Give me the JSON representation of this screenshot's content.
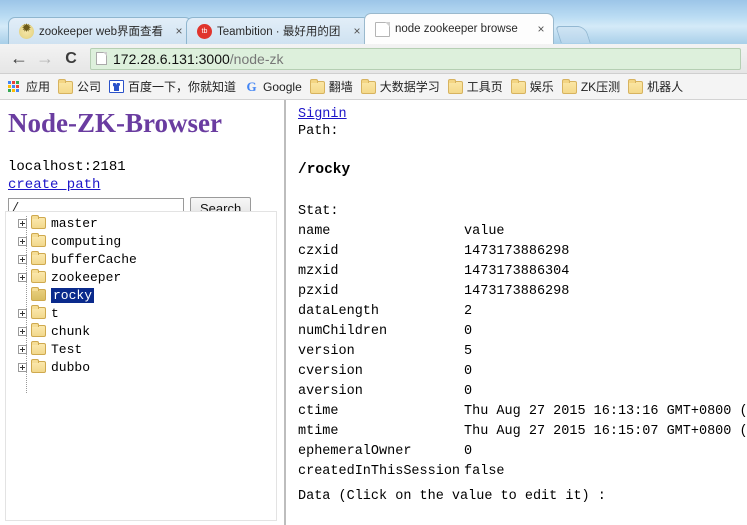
{
  "browser": {
    "tabs": [
      {
        "title": "zookeeper web界面查看",
        "favicon": "zookeeper-favicon",
        "active": false,
        "close_label": "×"
      },
      {
        "title": "Teambition · 最好用的团",
        "favicon": "teambition-favicon",
        "active": false,
        "close_label": "×"
      },
      {
        "title": "node zookeeper browse",
        "favicon": "document-favicon",
        "active": true,
        "close_label": "×"
      }
    ],
    "toolbar": {
      "back_icon": "←",
      "forward_icon": "→",
      "reload_icon": "C",
      "url_host": "172.28.6.131:3000",
      "url_path": "/node-zk"
    },
    "bookmarks": [
      {
        "label": "应用",
        "icon": "apps-grid-icon"
      },
      {
        "label": "公司",
        "icon": "folder-icon"
      },
      {
        "label": "百度一下，你就知道",
        "icon": "baidu-icon"
      },
      {
        "label": "Google",
        "icon": "google-icon"
      },
      {
        "label": "翻墙",
        "icon": "folder-icon"
      },
      {
        "label": "大数据学习",
        "icon": "folder-icon"
      },
      {
        "label": "工具页",
        "icon": "folder-icon"
      },
      {
        "label": "娱乐",
        "icon": "folder-icon"
      },
      {
        "label": "ZK压测",
        "icon": "folder-icon"
      },
      {
        "label": "机器人",
        "icon": "folder-icon"
      }
    ]
  },
  "sidebar": {
    "app_title": "Node-ZK-Browser",
    "host": "localhost:2181",
    "create_path_label": "create path",
    "search_value": "/",
    "search_button": "Search",
    "tree": [
      {
        "label": "master",
        "expandable": true,
        "selected": false
      },
      {
        "label": "computing",
        "expandable": true,
        "selected": false
      },
      {
        "label": "bufferCache",
        "expandable": true,
        "selected": false
      },
      {
        "label": "zookeeper",
        "expandable": true,
        "selected": false
      },
      {
        "label": "rocky",
        "expandable": false,
        "selected": true
      },
      {
        "label": "t",
        "expandable": true,
        "selected": false
      },
      {
        "label": "chunk",
        "expandable": true,
        "selected": false
      },
      {
        "label": "Test",
        "expandable": true,
        "selected": false
      },
      {
        "label": "dubbo",
        "expandable": true,
        "selected": false
      }
    ]
  },
  "main": {
    "signin_label": "Signin",
    "path_label": "Path:",
    "current_path": "/rocky",
    "stat_label": "Stat:",
    "stat_headers": {
      "name": "name",
      "value": "value"
    },
    "stat_rows": [
      {
        "key": "czxid",
        "value": "1473173886298"
      },
      {
        "key": "mzxid",
        "value": "1473173886304"
      },
      {
        "key": "pzxid",
        "value": "1473173886298"
      },
      {
        "key": "dataLength",
        "value": "2"
      },
      {
        "key": "numChildren",
        "value": "0"
      },
      {
        "key": "version",
        "value": "5"
      },
      {
        "key": "cversion",
        "value": "0"
      },
      {
        "key": "aversion",
        "value": "0"
      },
      {
        "key": "ctime",
        "value": "Thu Aug 27 2015 16:13:16 GMT+0800 ("
      },
      {
        "key": "mtime",
        "value": "Thu Aug 27 2015 16:15:07 GMT+0800 ("
      },
      {
        "key": "ephemeralOwner",
        "value": "0"
      },
      {
        "key": "createdInThisSession",
        "value": "false"
      }
    ],
    "data_label": "Data (Click on the value to edit it) :"
  },
  "colors": {
    "title_purple": "#6a3ca0",
    "link_blue": "#1c15c9",
    "selection_blue": "#0a2a8c",
    "omnibox_green": "#ddf0dc"
  }
}
